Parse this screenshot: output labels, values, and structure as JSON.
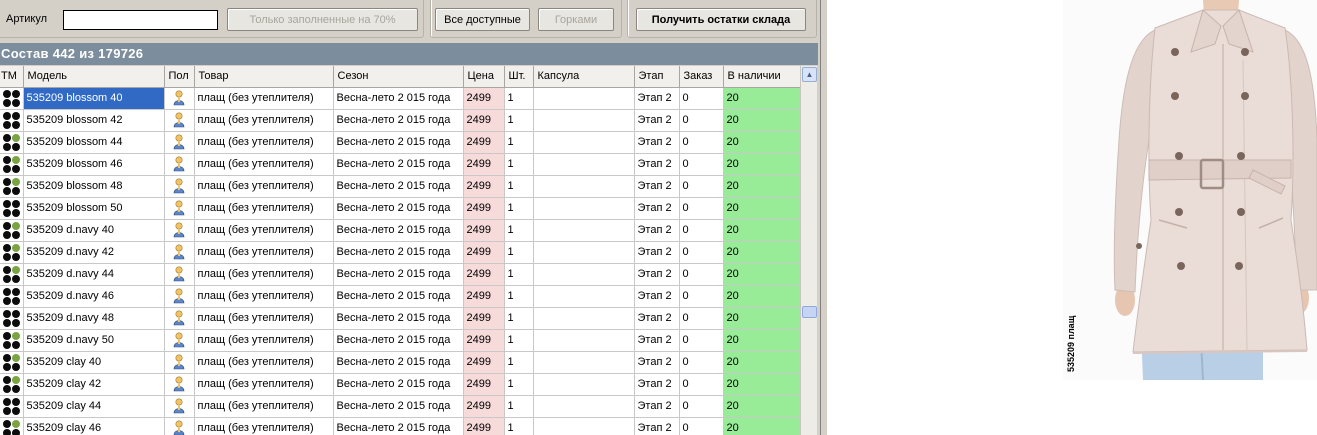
{
  "toolbar": {
    "artikul_label": "Артикул",
    "artikul_value": "",
    "filled70_button": "Только заполненные на 70%",
    "all_available_button": "Все доступные",
    "gorki_button": "Горками",
    "get_stock_button": "Получить остатки склада"
  },
  "grid_title": "Состав 442 из 179726",
  "columns": {
    "tm": "ТМ",
    "model": "Модель",
    "pol": "Пол",
    "tovar": "Товар",
    "sezon": "Сезон",
    "price": "Цена",
    "qty": "Шт.",
    "kapsula": "Капсула",
    "etap": "Этап",
    "zakaz": "Заказ",
    "stock": "В наличии"
  },
  "rows": [
    {
      "tm": "black",
      "model": "535209 blossom  40",
      "tovar": "плащ (без утеплителя)",
      "sezon": "Весна-лето 2 015 года",
      "price": "2499",
      "qty": "1",
      "kapsula": "",
      "etap": "Этап 2",
      "zakaz": "0",
      "stock": "20",
      "selected": true
    },
    {
      "tm": "black",
      "model": "535209 blossom  42",
      "tovar": "плащ (без утеплителя)",
      "sezon": "Весна-лето 2 015 года",
      "price": "2499",
      "qty": "1",
      "kapsula": "",
      "etap": "Этап 2",
      "zakaz": "0",
      "stock": "20"
    },
    {
      "tm": "green",
      "model": "535209 blossom  44",
      "tovar": "плащ (без утеплителя)",
      "sezon": "Весна-лето 2 015 года",
      "price": "2499",
      "qty": "1",
      "kapsula": "",
      "etap": "Этап 2",
      "zakaz": "0",
      "stock": "20"
    },
    {
      "tm": "green",
      "model": "535209 blossom  46",
      "tovar": "плащ (без утеплителя)",
      "sezon": "Весна-лето 2 015 года",
      "price": "2499",
      "qty": "1",
      "kapsula": "",
      "etap": "Этап 2",
      "zakaz": "0",
      "stock": "20"
    },
    {
      "tm": "green",
      "model": "535209 blossom  48",
      "tovar": "плащ (без утеплителя)",
      "sezon": "Весна-лето 2 015 года",
      "price": "2499",
      "qty": "1",
      "kapsula": "",
      "etap": "Этап 2",
      "zakaz": "0",
      "stock": "20"
    },
    {
      "tm": "black",
      "model": "535209 blossom  50",
      "tovar": "плащ (без утеплителя)",
      "sezon": "Весна-лето 2 015 года",
      "price": "2499",
      "qty": "1",
      "kapsula": "",
      "etap": "Этап 2",
      "zakaz": "0",
      "stock": "20"
    },
    {
      "tm": "green",
      "model": "535209 d.navy  40",
      "tovar": "плащ (без утеплителя)",
      "sezon": "Весна-лето 2 015 года",
      "price": "2499",
      "qty": "1",
      "kapsula": "",
      "etap": "Этап 2",
      "zakaz": "0",
      "stock": "20"
    },
    {
      "tm": "green",
      "model": "535209 d.navy  42",
      "tovar": "плащ (без утеплителя)",
      "sezon": "Весна-лето 2 015 года",
      "price": "2499",
      "qty": "1",
      "kapsula": "",
      "etap": "Этап 2",
      "zakaz": "0",
      "stock": "20"
    },
    {
      "tm": "green",
      "model": "535209 d.navy  44",
      "tovar": "плащ (без утеплителя)",
      "sezon": "Весна-лето 2 015 года",
      "price": "2499",
      "qty": "1",
      "kapsula": "",
      "etap": "Этап 2",
      "zakaz": "0",
      "stock": "20"
    },
    {
      "tm": "black",
      "model": "535209 d.navy  46",
      "tovar": "плащ (без утеплителя)",
      "sezon": "Весна-лето 2 015 года",
      "price": "2499",
      "qty": "1",
      "kapsula": "",
      "etap": "Этап 2",
      "zakaz": "0",
      "stock": "20"
    },
    {
      "tm": "black",
      "model": "535209 d.navy  48",
      "tovar": "плащ (без утеплителя)",
      "sezon": "Весна-лето 2 015 года",
      "price": "2499",
      "qty": "1",
      "kapsula": "",
      "etap": "Этап 2",
      "zakaz": "0",
      "stock": "20"
    },
    {
      "tm": "green",
      "model": "535209 d.navy  50",
      "tovar": "плащ (без утеплителя)",
      "sezon": "Весна-лето 2 015 года",
      "price": "2499",
      "qty": "1",
      "kapsula": "",
      "etap": "Этап 2",
      "zakaz": "0",
      "stock": "20"
    },
    {
      "tm": "green",
      "model": "535209 clay  40",
      "tovar": "плащ (без утеплителя)",
      "sezon": "Весна-лето 2 015 года",
      "price": "2499",
      "qty": "1",
      "kapsula": "",
      "etap": "Этап 2",
      "zakaz": "0",
      "stock": "20"
    },
    {
      "tm": "green",
      "model": "535209 clay  42",
      "tovar": "плащ (без утеплителя)",
      "sezon": "Весна-лето 2 015 года",
      "price": "2499",
      "qty": "1",
      "kapsula": "",
      "etap": "Этап 2",
      "zakaz": "0",
      "stock": "20"
    },
    {
      "tm": "black",
      "model": "535209 clay  44",
      "tovar": "плащ (без утеплителя)",
      "sezon": "Весна-лето 2 015 года",
      "price": "2499",
      "qty": "1",
      "kapsula": "",
      "etap": "Этап 2",
      "zakaz": "0",
      "stock": "20"
    },
    {
      "tm": "green",
      "model": "535209 clay  46",
      "tovar": "плащ (без утеплителя)",
      "sezon": "Весна-лето 2 015 года",
      "price": "2499",
      "qty": "1",
      "kapsula": "",
      "etap": "Этап 2",
      "zakaz": "0",
      "stock": "20"
    }
  ],
  "photo_caption": "535209 плащ",
  "colors": {
    "price_bg": "#f7dada",
    "stock_bg": "#98ec98",
    "selection": "#316ac5",
    "title_bar": "#7c8e9d"
  }
}
